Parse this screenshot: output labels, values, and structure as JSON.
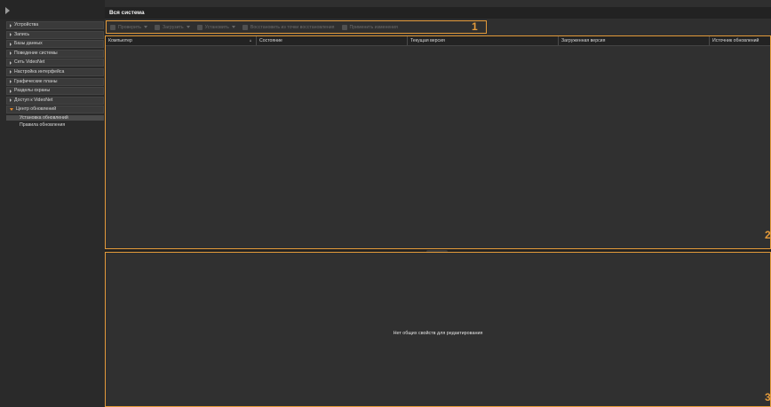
{
  "header": {
    "title": "Вся система"
  },
  "sidebar": {
    "items": [
      {
        "label": "Устройства"
      },
      {
        "label": "Запись"
      },
      {
        "label": "Базы данных"
      },
      {
        "label": "Поведение системы"
      },
      {
        "label": "Сеть VideoNet"
      },
      {
        "label": "Настройка интерфейса"
      },
      {
        "label": "Графические планы"
      },
      {
        "label": "Разделы охраны"
      },
      {
        "label": "Доступ к VideoNet"
      },
      {
        "label": "Центр обновлений",
        "expanded": true
      }
    ],
    "subitems": [
      {
        "label": "Установка обновлений",
        "selected": true
      },
      {
        "label": "Правила обновления",
        "selected": false
      }
    ]
  },
  "toolbar": {
    "buttons": [
      {
        "label": "Проверить",
        "icon": "check-icon"
      },
      {
        "label": "Загрузить",
        "icon": "download-icon"
      },
      {
        "label": "Установить",
        "icon": "install-icon"
      },
      {
        "label": "Восстановить из точки восстановления",
        "icon": "restore-icon"
      },
      {
        "label": "Применить изменения",
        "icon": "apply-icon"
      }
    ]
  },
  "grid": {
    "columns": [
      "Компьютер",
      "Состояние",
      "Текущая версия",
      "Загруженная версия",
      "Источник обновлений"
    ]
  },
  "properties": {
    "empty_message": "Нет общих свойств для редактирования"
  },
  "callouts": [
    "1",
    "2",
    "3"
  ],
  "colors": {
    "callout": "#e39a3a",
    "background": "#2f2f2f",
    "header": "#222222"
  }
}
